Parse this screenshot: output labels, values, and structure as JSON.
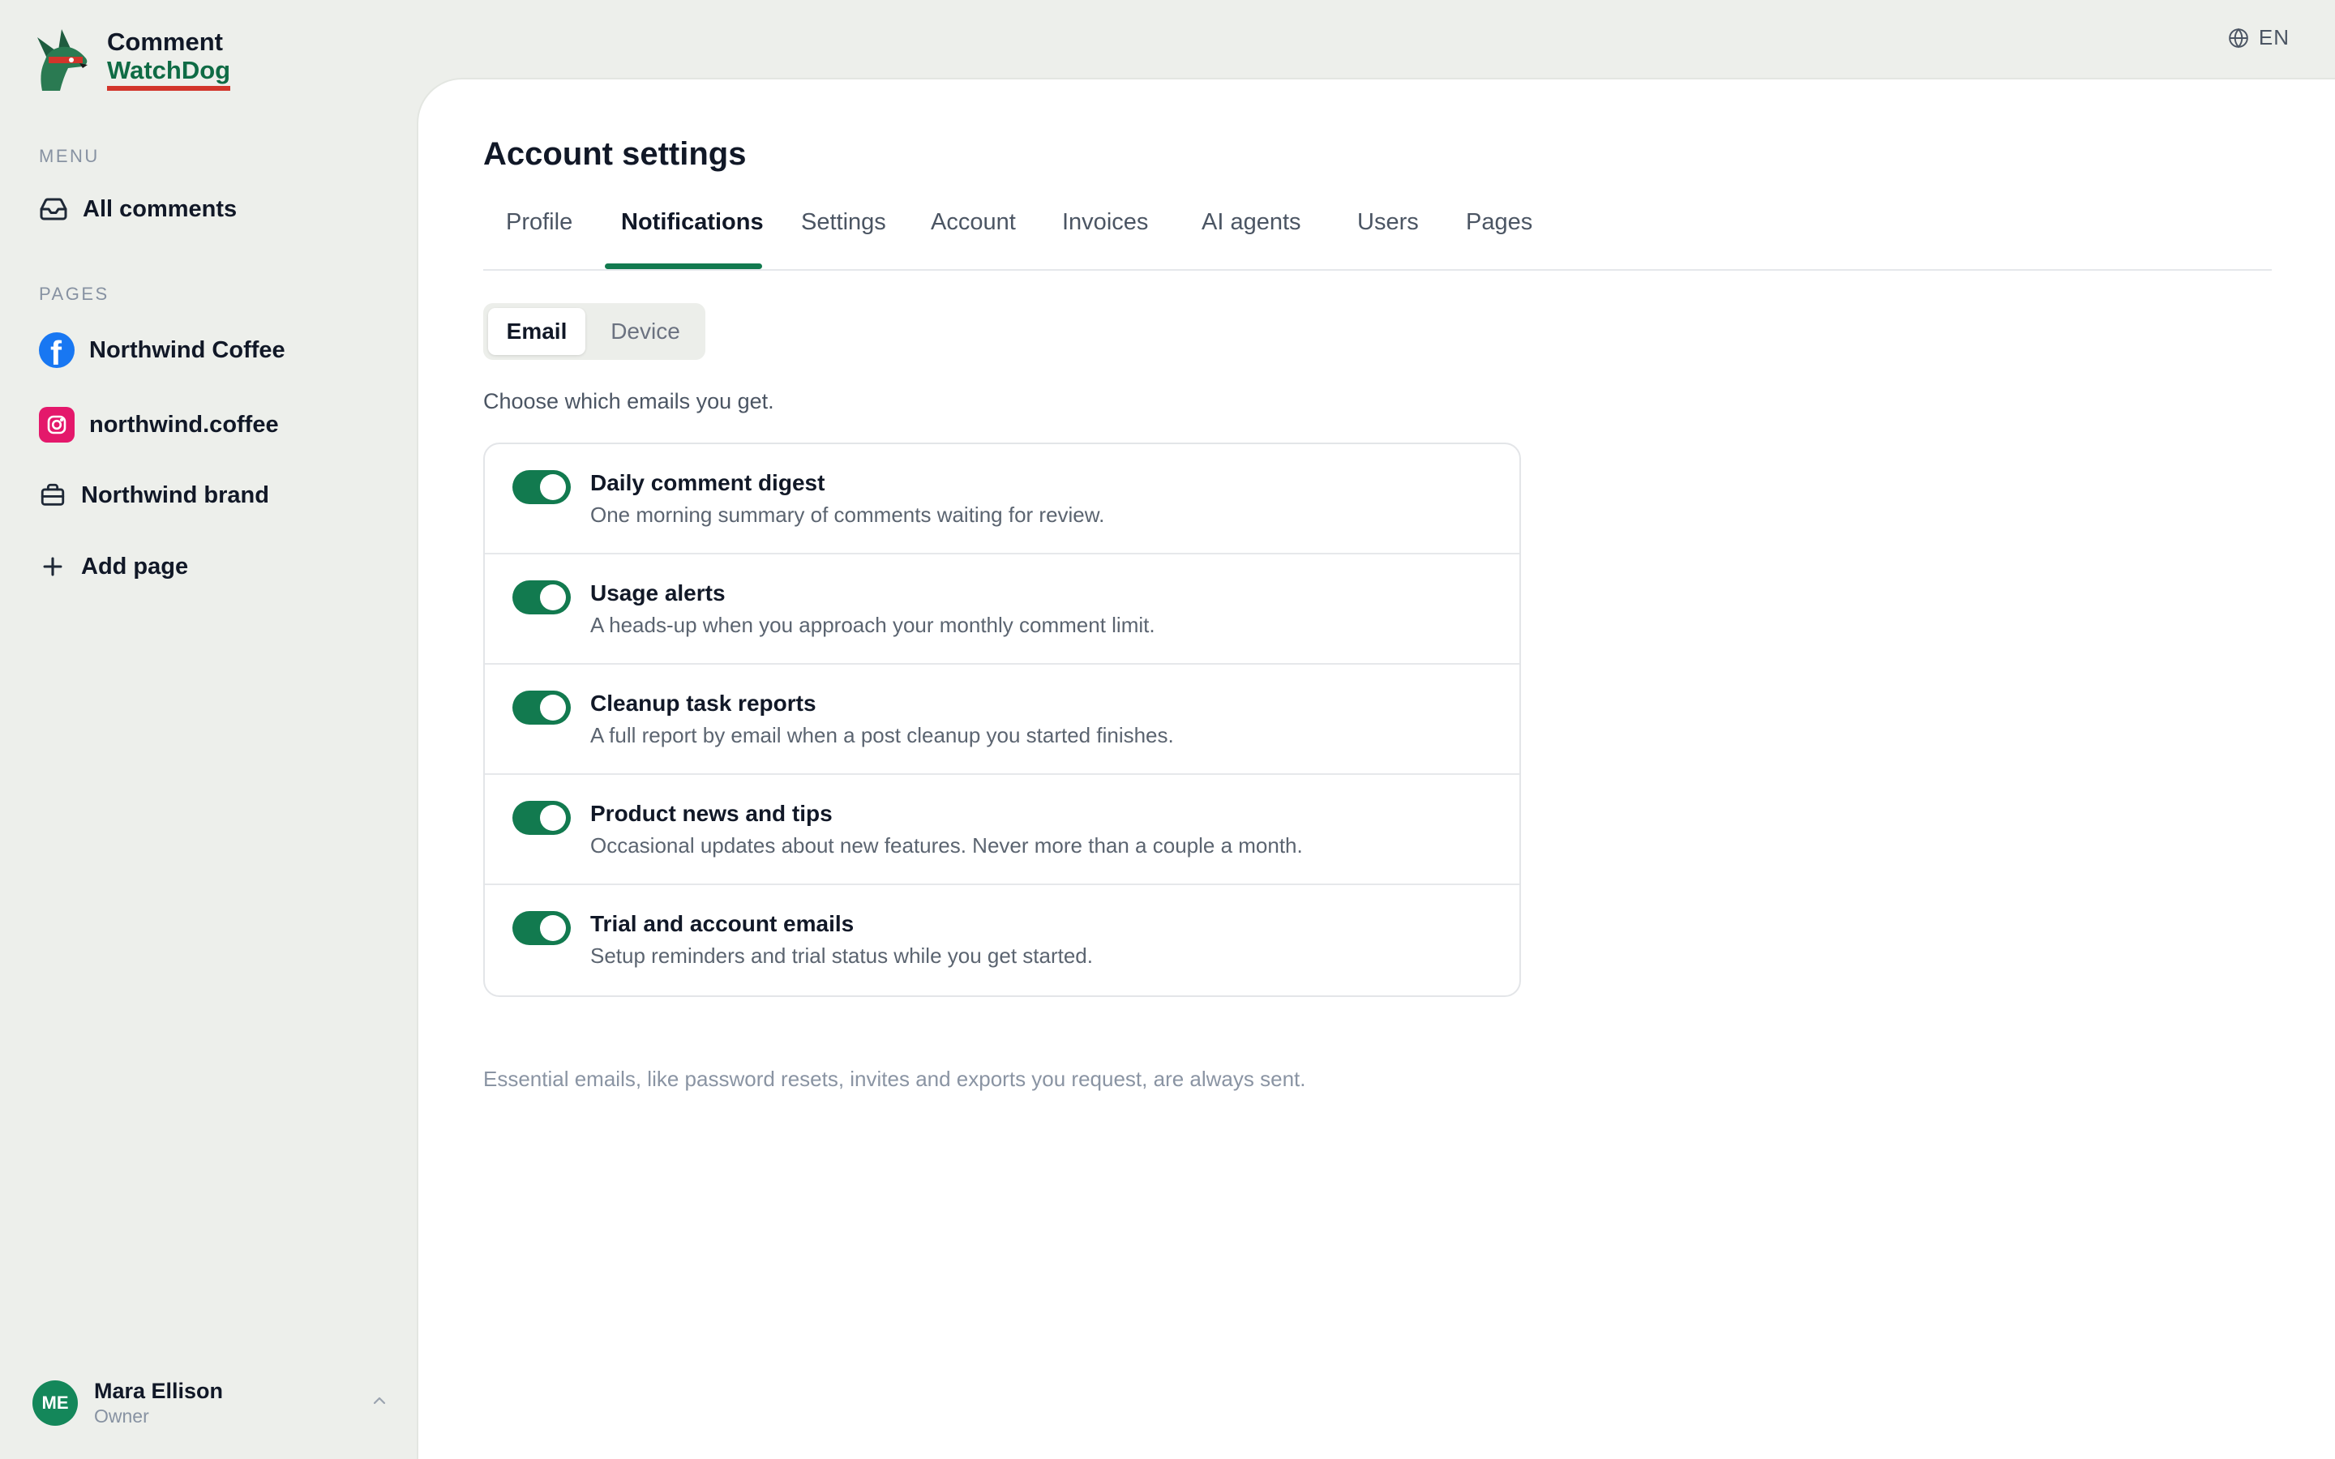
{
  "brand": {
    "line1": "Comment",
    "line2": "WatchDog"
  },
  "sidebar": {
    "menu_label": "MENU",
    "menu_items": [
      {
        "label": "All comments",
        "icon": "inbox-icon"
      }
    ],
    "pages_label": "PAGES",
    "pages": [
      {
        "label": "Northwind Coffee",
        "icon": "facebook-icon"
      },
      {
        "label": "northwind.coffee",
        "icon": "instagram-icon"
      },
      {
        "label": "Northwind brand",
        "icon": "briefcase-icon"
      }
    ],
    "add_page_label": "Add page"
  },
  "user": {
    "initials": "ME",
    "name": "Mara Ellison",
    "role": "Owner"
  },
  "language": {
    "code": "EN",
    "icon": "globe-icon"
  },
  "main": {
    "title": "Account settings",
    "tabs": [
      "Profile",
      "Notifications",
      "Settings",
      "Account",
      "Invoices",
      "AI agents",
      "Users",
      "Pages"
    ],
    "active_tab": "Notifications",
    "segments": [
      "Email",
      "Device"
    ],
    "active_segment": "Email",
    "description": "Choose which emails you get.",
    "notifications": [
      {
        "title": "Daily comment digest",
        "subtitle": "One morning summary of comments waiting for review.",
        "enabled": true
      },
      {
        "title": "Usage alerts",
        "subtitle": "A heads-up when you approach your monthly comment limit.",
        "enabled": true
      },
      {
        "title": "Cleanup task reports",
        "subtitle": "A full report by email when a post cleanup you started finishes.",
        "enabled": true
      },
      {
        "title": "Product news and tips",
        "subtitle": "Occasional updates about new features. Never more than a couple a month.",
        "enabled": true
      },
      {
        "title": "Trial and account emails",
        "subtitle": "Setup reminders and trial status while you get started.",
        "enabled": true
      }
    ],
    "footnote": "Essential emails, like password resets, invites and exports you request, are always sent."
  },
  "colors": {
    "accent": "#127a4f",
    "brand_red": "#d2352b",
    "facebook": "#1877f2",
    "instagram": "#e4186b",
    "sidebar_bg": "#edefeb"
  }
}
